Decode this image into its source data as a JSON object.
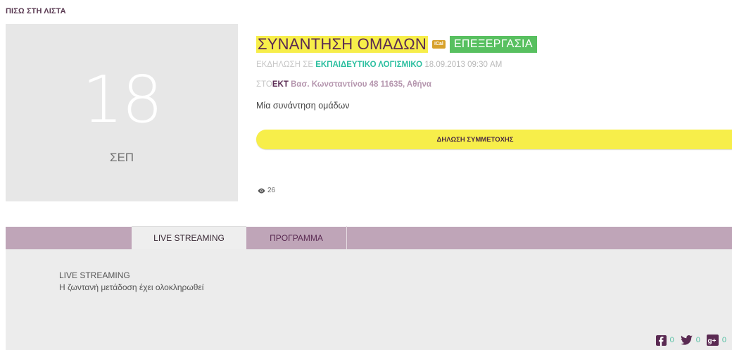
{
  "nav": {
    "back_label": "ΠΙΣΩ ΣΤΗ ΛΙΣΤΑ"
  },
  "event": {
    "day": "18",
    "month": "ΣΕΠ",
    "title": "ΣΥΝΑΝΤΗΣΗ ΟΜΑΔΩΝ",
    "ical_label": "iCal",
    "edit_label": "ΕΠΕΞΕΡΓΑΣΙΑ",
    "meta_prefix": "ΕΚΔΗΛΩΣΗ ΣΕ",
    "category": "ΕΚΠΑΙΔΕΥΤΙΚΟ ΛΟΓΙΣΜΙΚΟ",
    "datetime": "18.09.2013 09:30 AM",
    "loc_prefix": "ΣΤΟ",
    "organizer": "ΕΚΤ",
    "address": "Βασ. Κωνσταντίνου 48 11635, Αθήνα",
    "description": "Μία συνάντηση ομάδων",
    "attend_label": "ΔΗΛΩΣΗ ΣΥΜΜΕΤΟΧΗΣ",
    "views": "26"
  },
  "tabs": {
    "live_label": "LIVE STREAMING",
    "program_label": "ΠΡΟΓΡΑΜΜΑ"
  },
  "panel": {
    "title": "LIVE STREAMING",
    "text": "Η ζωντανή μετάδοση έχει ολοκληρωθεί"
  },
  "social": {
    "facebook_count": "0",
    "twitter_count": "0",
    "google_count": "0"
  },
  "colors": {
    "highlight": "#f7ee4a",
    "edit_green": "#58c060",
    "tab_bar": "#bfa5b8",
    "category_teal": "#2cbfa0",
    "brand_purple": "#5a2a52"
  }
}
